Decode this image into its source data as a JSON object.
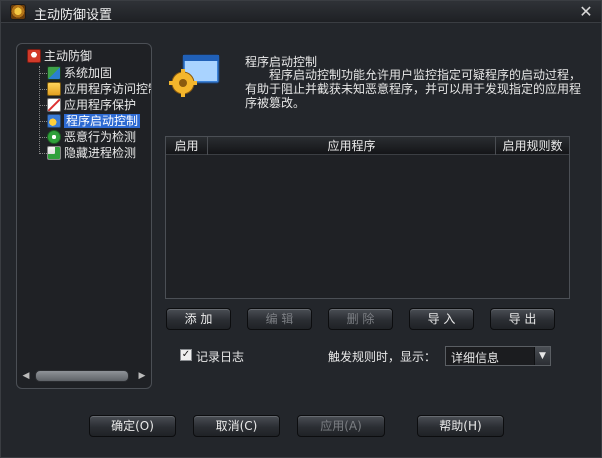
{
  "window": {
    "title": "主动防御设置",
    "close_symbol": "✕"
  },
  "tree": {
    "root_label": "主动防御",
    "items": [
      {
        "label": "系统加固",
        "icon": "system-hardening-icon"
      },
      {
        "label": "应用程序访问控制",
        "icon": "app-access-control-icon"
      },
      {
        "label": "应用程序保护",
        "icon": "app-protection-icon"
      },
      {
        "label": "程序启动控制",
        "icon": "program-launch-control-icon",
        "selected": true
      },
      {
        "label": "恶意行为检测",
        "icon": "malicious-behavior-icon"
      },
      {
        "label": "隐藏进程检测",
        "icon": "hidden-process-icon"
      }
    ]
  },
  "section": {
    "title": "程序启动控制",
    "description": "程序启动控制功能允许用户监控指定可疑程序的启动过程，有助于阻止并截获未知恶意程序，并可以用于发现指定的应用程序被篡改。"
  },
  "table": {
    "columns": [
      "启用",
      "应用程序",
      "启用规则数"
    ],
    "rows": []
  },
  "actions": {
    "add": "添 加",
    "edit": "编 辑",
    "delete": "删 除",
    "import": "导 入",
    "export": "导 出"
  },
  "log": {
    "checkbox_label": "记录日志",
    "checked": true,
    "trigger_label": "触发规则时，显示：",
    "selected_option": "详细信息"
  },
  "footer": {
    "ok": "确定(O)",
    "cancel": "取消(C)",
    "apply": "应用(A)",
    "help": "帮助(H)"
  },
  "colors": {
    "selection": "#2d6ad2",
    "background": "#23262b"
  }
}
